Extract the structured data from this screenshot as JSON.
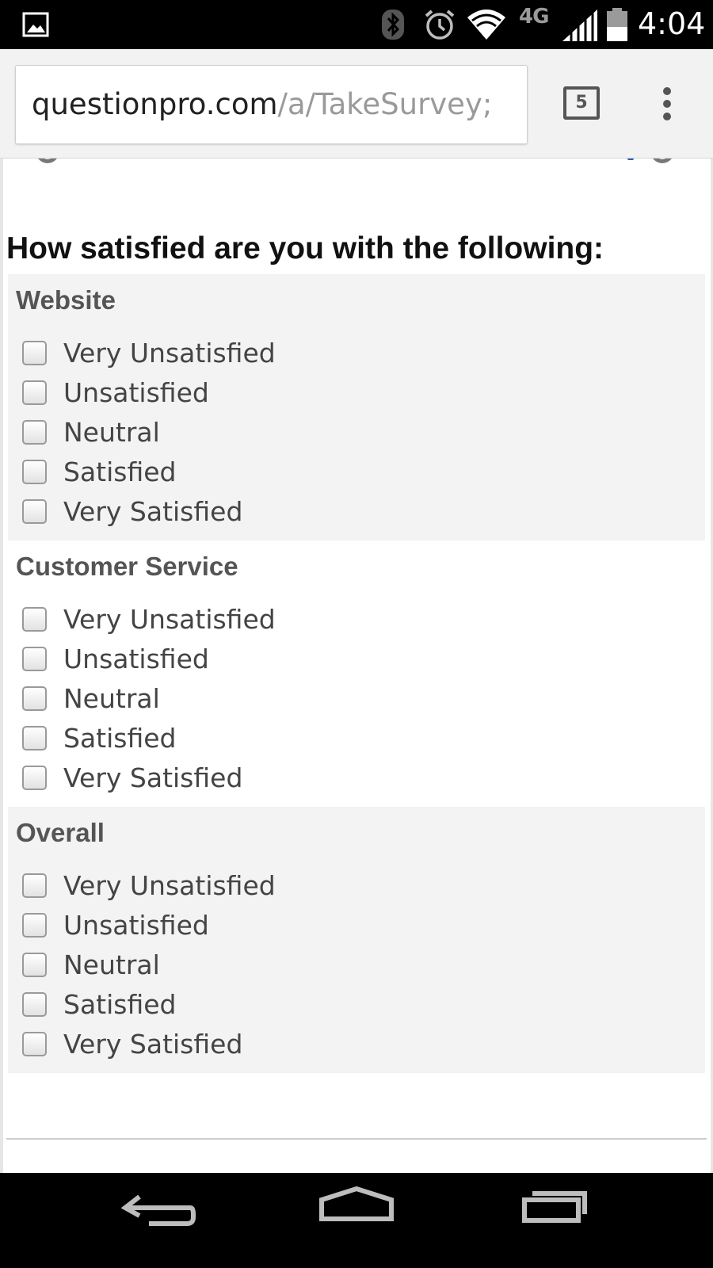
{
  "status_bar": {
    "network": "4G",
    "time": "4:04",
    "icons": [
      "gallery-icon",
      "bluetooth-icon",
      "alarm-icon",
      "wifi-icon",
      "signal-icon",
      "battery-icon"
    ]
  },
  "browser": {
    "url_domain": "questionpro.com",
    "url_path": "/a/TakeSurvey;",
    "tab_count": "5",
    "menu_icon": "overflow-menu-icon"
  },
  "survey": {
    "question": "How satisfied are you with the following:",
    "groups": [
      {
        "label": "Website",
        "options": [
          "Very Unsatisfied",
          "Unsatisfied",
          "Neutral",
          "Satisfied",
          "Very Satisfied"
        ]
      },
      {
        "label": "Customer Service",
        "options": [
          "Very Unsatisfied",
          "Unsatisfied",
          "Neutral",
          "Satisfied",
          "Very Satisfied"
        ]
      },
      {
        "label": "Overall",
        "options": [
          "Very Unsatisfied",
          "Unsatisfied",
          "Neutral",
          "Satisfied",
          "Very Satisfied"
        ]
      }
    ]
  },
  "nav_bar": {
    "icons": [
      "back-icon",
      "home-icon",
      "recents-icon"
    ]
  },
  "colors": {
    "status_bar_bg": "#000000",
    "shaded_group_bg": "#f3f3f3",
    "label_text": "#555555",
    "option_text": "#444444"
  }
}
